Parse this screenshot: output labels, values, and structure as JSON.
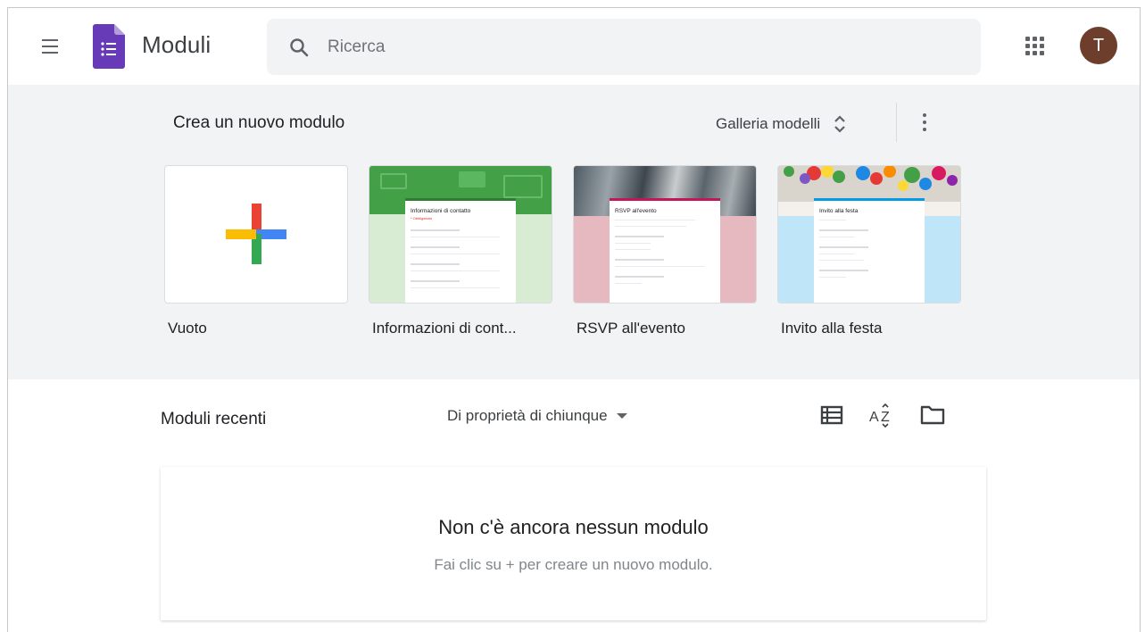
{
  "header": {
    "app_name": "Moduli",
    "search_placeholder": "Ricerca",
    "avatar_initial": "T",
    "brand_color": "#673ab7",
    "avatar_color": "#6d3e2c"
  },
  "gallery": {
    "title": "Crea un nuovo modulo",
    "toggle_label": "Galleria modelli",
    "templates": [
      {
        "label": "Vuoto",
        "icon": "google-colors-plus-icon"
      },
      {
        "label": "Informazioni di cont...",
        "thumb_title": "Informazioni di contatto",
        "theme_color": "#43a047"
      },
      {
        "label": "RSVP all'evento",
        "thumb_title": "RSVP all'evento",
        "theme_color": "#e6b8bf"
      },
      {
        "label": "Invito alla festa",
        "thumb_title": "Invito alla festa",
        "theme_color": "#bfe6f8"
      }
    ]
  },
  "recent": {
    "title": "Moduli recenti",
    "owner_filter": "Di proprietà di chiunque",
    "empty_title": "Non c'è ancora nessun modulo",
    "empty_subtitle": "Fai clic su + per creare un nuovo modulo."
  }
}
